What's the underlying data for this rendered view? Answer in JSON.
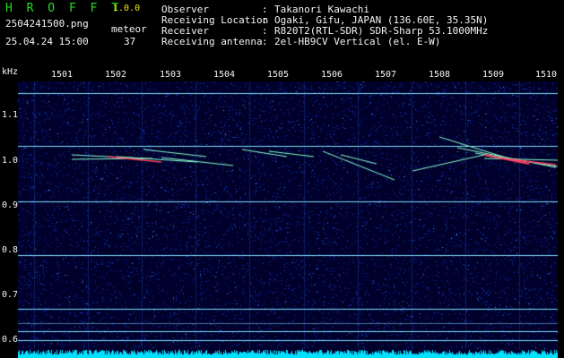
{
  "header": {
    "app_title": "H R O F F T",
    "version": "1.0.0",
    "filename": "2504241500.png",
    "timestamp": "25.04.24 15:00",
    "detection_label": "meteor",
    "detection_count": "37"
  },
  "info": {
    "rows": [
      {
        "key": "Observer",
        "value": "Takanori Kawachi"
      },
      {
        "key": "Receiving Location",
        "value": "Ogaki, Gifu, JAPAN (136.60E, 35.35N)"
      },
      {
        "key": "Receiver",
        "value": "R820T2(RTL-SDR) SDR-Sharp 53.1000MHz"
      },
      {
        "key": "Receiving antenna",
        "value": "2el-HB9CV Vertical (el. E-W)"
      }
    ]
  },
  "axes": {
    "y_unit": "kHz",
    "y_ticks": [
      "1.1",
      "1.0",
      "0.9",
      "0.8",
      "0.7",
      "0.6"
    ],
    "x_ticks": [
      "1501",
      "1502",
      "1503",
      "1504",
      "1505",
      "1506",
      "1507",
      "1508",
      "1509",
      "1510"
    ]
  },
  "colors": {
    "background": "#00002a",
    "noise": "#1a3fd0",
    "carrier": "#7fe0ff",
    "trace": "#88ffcc",
    "hot": "#ff4060",
    "bottom_band": "#00e0ff"
  }
}
